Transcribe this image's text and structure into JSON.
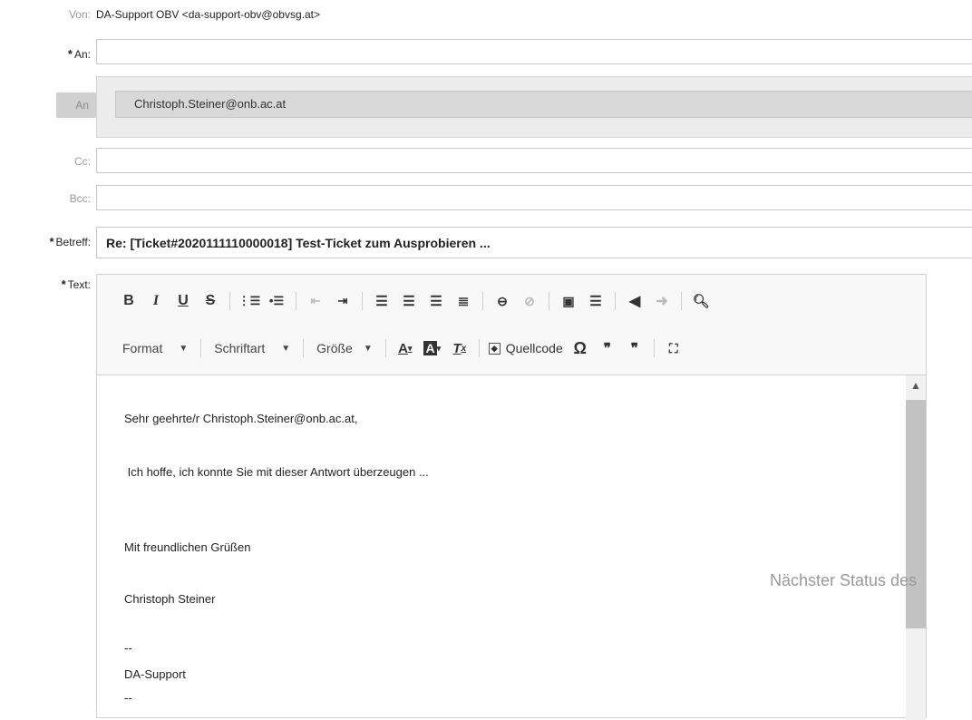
{
  "from": {
    "label": "Von:",
    "value": "DA-Support OBV <da-support-obv@obvsg.at>"
  },
  "to": {
    "label": "An:",
    "star": "*",
    "tag": "An",
    "recipient": "Christoph.Steiner@onb.ac.at"
  },
  "cc": {
    "label": "Cc:"
  },
  "bcc": {
    "label": "Bcc:"
  },
  "subject": {
    "label": "Betreff:",
    "star": "*",
    "value": "Re: [Ticket#2020111110000018] Test-Ticket zum Ausprobieren ..."
  },
  "text": {
    "label": "Text:",
    "star": "*"
  },
  "toolbar": {
    "format_label": "Format",
    "font_label": "Schriftart",
    "size_label": "Größe",
    "source_label": "Quellcode",
    "icons": [
      "bold-icon",
      "italic-icon",
      "underline-icon",
      "strikethrough-icon",
      "numbered-list-icon",
      "bulleted-list-icon",
      "outdent-icon",
      "indent-icon",
      "align-left-icon",
      "align-center-icon",
      "align-right-icon",
      "justify-icon",
      "link-icon",
      "unlink-icon",
      "image-icon",
      "horizontal-rule-icon",
      "undo-icon",
      "redo-icon",
      "search-icon",
      "text-color-icon",
      "background-color-icon",
      "remove-format-icon",
      "source-icon",
      "special-char-icon",
      "blockquote-icon",
      "remove-blockquote-icon",
      "maximize-icon"
    ]
  },
  "body_lines": [
    "Sehr geehrte/r Christoph.Steiner@onb.ac.at,",
    " Ich hoffe, ich konnte Sie mit dieser Antwort überzeugen ...",
    "Mit freundlichen Grüßen",
    "Christoph Steiner",
    "--",
    "DA-Support",
    "--"
  ],
  "next_status_label": "Nächster Status des"
}
